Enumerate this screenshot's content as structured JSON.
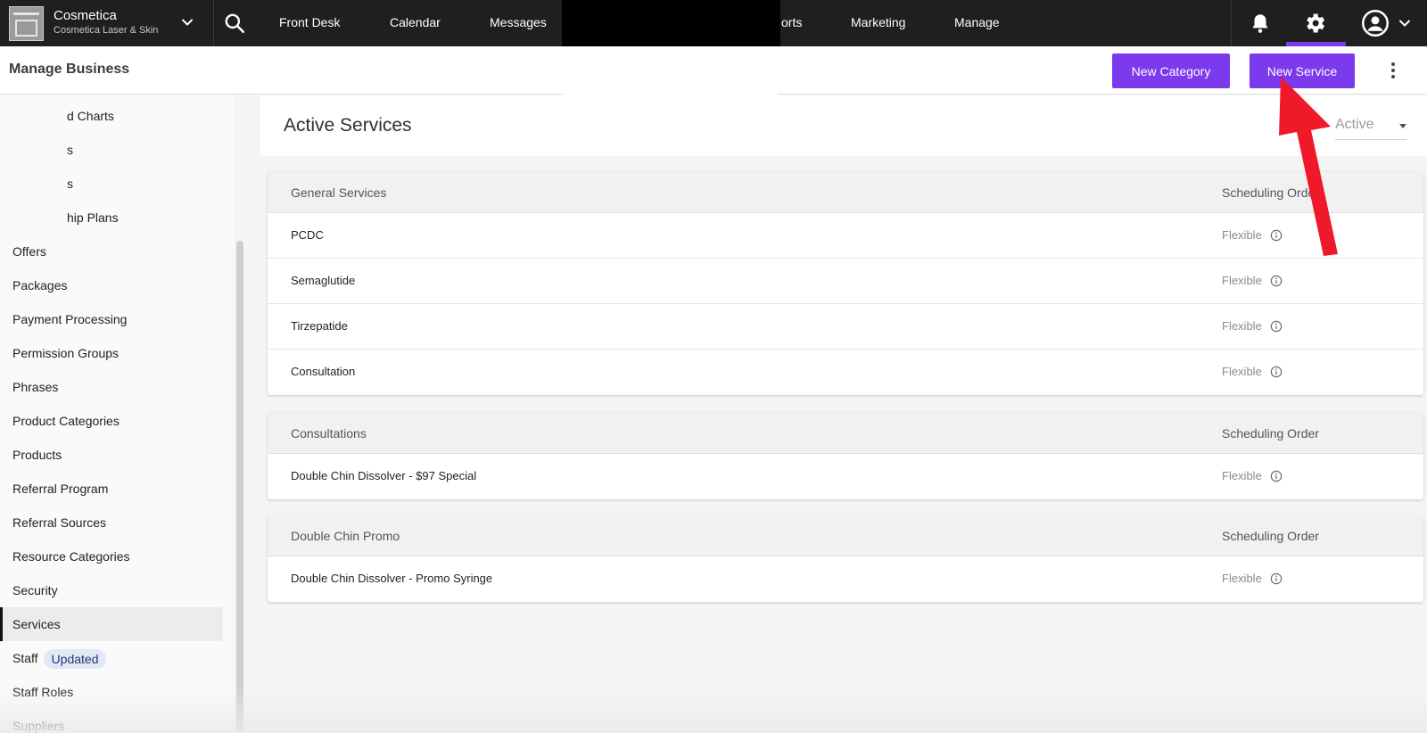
{
  "brand": {
    "name": "Cosmetica",
    "subtitle": "Cosmetica Laser & Skin"
  },
  "nav": {
    "front_desk": "Front Desk",
    "calendar": "Calendar",
    "messages": "Messages",
    "reports_partial": "orts",
    "marketing": "Marketing",
    "manage": "Manage"
  },
  "colors": {
    "accent": "#7c3aed",
    "topbar": "#1f1f1f",
    "arrow": "#f0192a"
  },
  "subbar": {
    "title": "Manage Business",
    "new_category": "New Category",
    "new_service": "New Service"
  },
  "sidebar": {
    "items": [
      {
        "label": "d Charts"
      },
      {
        "label": "s"
      },
      {
        "label": "s"
      },
      {
        "label": "hip Plans"
      },
      {
        "label": "Offers"
      },
      {
        "label": "Packages"
      },
      {
        "label": "Payment Processing"
      },
      {
        "label": "Permission Groups"
      },
      {
        "label": "Phrases"
      },
      {
        "label": "Product Categories"
      },
      {
        "label": "Products"
      },
      {
        "label": "Referral Program"
      },
      {
        "label": "Referral Sources"
      },
      {
        "label": "Resource Categories"
      },
      {
        "label": "Security"
      },
      {
        "label": "Services"
      },
      {
        "label": "Staff",
        "badge": "Updated"
      },
      {
        "label": "Staff Roles"
      },
      {
        "label": "Suppliers"
      }
    ]
  },
  "main": {
    "title": "Active Services",
    "status_filter": "Active",
    "categories": [
      {
        "name": "General Services",
        "order_label": "Scheduling Order",
        "services": [
          {
            "name": "PCDC",
            "order": "Flexible"
          },
          {
            "name": "Semaglutide",
            "order": "Flexible"
          },
          {
            "name": "Tirzepatide",
            "order": "Flexible"
          },
          {
            "name": "Consultation",
            "order": "Flexible"
          }
        ]
      },
      {
        "name": "Consultations",
        "order_label": "Scheduling Order",
        "services": [
          {
            "name": "Double Chin Dissolver - $97 Special",
            "order": "Flexible"
          }
        ]
      },
      {
        "name": "Double Chin Promo",
        "order_label": "Scheduling Order",
        "services": [
          {
            "name": "Double Chin Dissolver - Promo Syringe",
            "order": "Flexible"
          }
        ]
      }
    ]
  },
  "icons": {
    "search": "search-icon",
    "bell": "bell-icon",
    "gear": "gear-icon",
    "avatar": "account-circle-icon",
    "kebab": "more-vertical-icon",
    "info": "info-icon",
    "chevron": "chevron-down-icon"
  }
}
